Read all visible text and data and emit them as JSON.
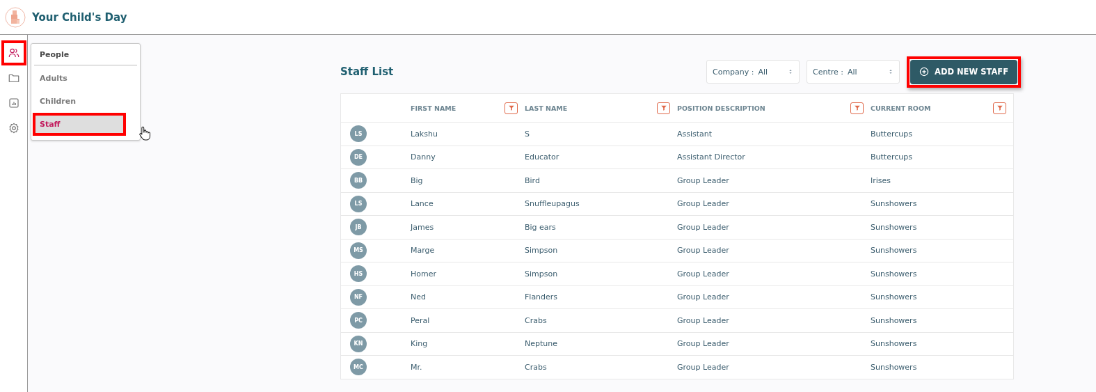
{
  "app": {
    "title": "Your Child's Day"
  },
  "rail": [
    {
      "kind": "people",
      "selected": true,
      "highlighted": true
    },
    {
      "kind": "folder",
      "selected": false,
      "highlighted": false
    },
    {
      "kind": "chart",
      "selected": false,
      "highlighted": false
    },
    {
      "kind": "settings",
      "selected": false,
      "highlighted": false
    }
  ],
  "menu": {
    "heading": "People",
    "items": [
      {
        "label": "Adults",
        "selected": false,
        "highlighted": false
      },
      {
        "label": "Children",
        "selected": false,
        "highlighted": false
      },
      {
        "label": "Staff",
        "selected": true,
        "highlighted": true,
        "hovered": true
      }
    ]
  },
  "page": {
    "title": "Staff List",
    "filters": [
      {
        "label": "Company :",
        "value": "All"
      },
      {
        "label": "Centre :",
        "value": "All"
      }
    ],
    "add_button": {
      "label": "ADD NEW STAFF",
      "highlighted": true
    }
  },
  "table": {
    "columns": [
      "FIRST NAME",
      "LAST NAME",
      "POSITION DESCRIPTION",
      "CURRENT ROOM"
    ],
    "rows": [
      {
        "initials": "LS",
        "cells": [
          "Lakshu",
          "S",
          "Assistant",
          "Buttercups"
        ]
      },
      {
        "initials": "DE",
        "cells": [
          "Danny",
          "Educator",
          "Assistant Director",
          "Buttercups"
        ]
      },
      {
        "initials": "BB",
        "cells": [
          "Big",
          "Bird",
          "Group Leader",
          "Irises"
        ]
      },
      {
        "initials": "LS",
        "cells": [
          "Lance",
          "Snuffleupagus",
          "Group Leader",
          "Sunshowers"
        ]
      },
      {
        "initials": "JB",
        "cells": [
          "James",
          "Big ears",
          "Group Leader",
          "Sunshowers"
        ]
      },
      {
        "initials": "MS",
        "cells": [
          "Marge",
          "Simpson",
          "Group Leader",
          "Sunshowers"
        ]
      },
      {
        "initials": "HS",
        "cells": [
          "Homer",
          "Simpson",
          "Group Leader",
          "Sunshowers"
        ]
      },
      {
        "initials": "NF",
        "cells": [
          "Ned",
          "Flanders",
          "Group Leader",
          "Sunshowers"
        ]
      },
      {
        "initials": "PC",
        "cells": [
          "Peral",
          "Crabs",
          "Group Leader",
          "Sunshowers"
        ]
      },
      {
        "initials": "KN",
        "cells": [
          "King",
          "Neptune",
          "Group Leader",
          "Sunshowers"
        ]
      },
      {
        "initials": "MC",
        "cells": [
          "Mr.",
          "Crabs",
          "Group Leader",
          "Sunshowers"
        ]
      }
    ]
  }
}
